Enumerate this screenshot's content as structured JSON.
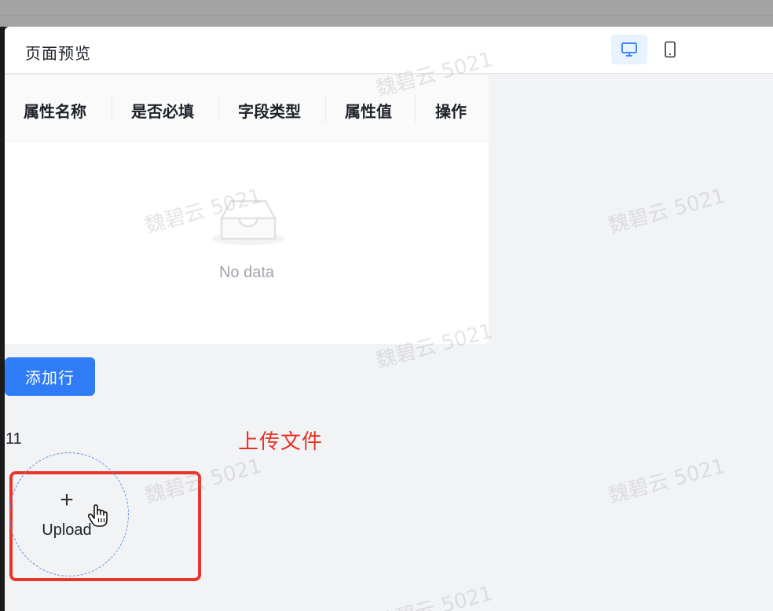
{
  "modal": {
    "title": "页面预览",
    "devices": [
      {
        "icon": "desktop-icon",
        "active": true
      },
      {
        "icon": "mobile-icon",
        "active": false
      }
    ]
  },
  "table": {
    "columns": [
      "属性名称",
      "是否必填",
      "字段类型",
      "属性值",
      "操作"
    ],
    "empty_text": "No data"
  },
  "add_row_label": "添加行",
  "field_label": "11",
  "annotation": "上传文件",
  "upload": {
    "plus": "+",
    "label": "Upload"
  },
  "watermark_text": "魏碧云 5021",
  "colors": {
    "primary": "#2f7cf6",
    "annotation_red": "#e53326",
    "highlight_border": "#e8352a"
  }
}
